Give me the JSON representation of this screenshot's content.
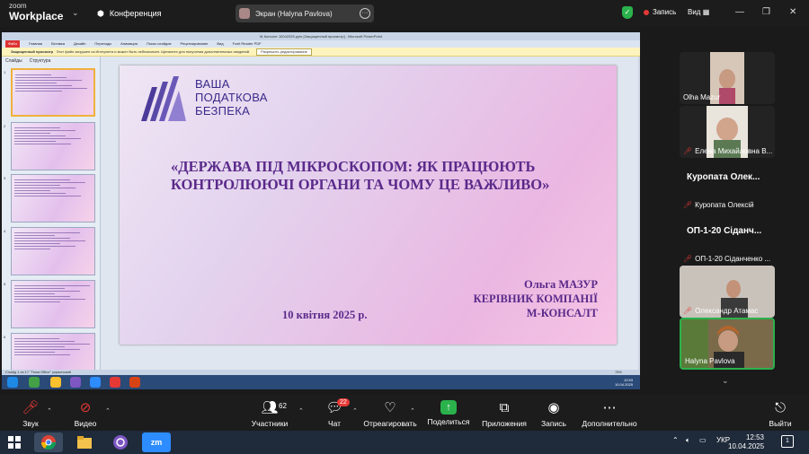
{
  "zoom": {
    "logo_top": "zoom",
    "logo_bottom": "Workplace",
    "conference_label": "Конференция",
    "share_label": "Экран (Halyna Pavlova)",
    "record_label": "Запись",
    "view_label": "Вид",
    "colors": {
      "accent_green": "#2bb24c",
      "record_red": "#e53935"
    }
  },
  "ppt": {
    "window_title": "М-Консалт 10042025.pptx [Защищенный просмотр] - Microsoft PowerPoint",
    "tabs": [
      "Файл",
      "Главная",
      "Вставка",
      "Дизайн",
      "Переходы",
      "Анимация",
      "Показ слайдов",
      "Рецензирование",
      "Вид",
      "Foxit Reader PDF"
    ],
    "warning_prefix": "Защищенный просмотр",
    "warning_text": "Этот файл загружен из Интернета и может быть небезопасен. Щелкните для получения дополнительных сведений.",
    "enable_editing": "Разрешить редактирование",
    "left_tabs": [
      "Слайды",
      "Структура"
    ],
    "thumb_numbers": [
      "1",
      "2",
      "3",
      "4",
      "5",
      "6"
    ],
    "status_text": "Слайд 1 из 17   \"Тема Office\"   украинский",
    "zoom_pct": "78%",
    "clock_time": "12:53",
    "clock_date": "10.04.2025"
  },
  "slide": {
    "logo_line1": "ВАША",
    "logo_line2": "ПОДАТКОВА",
    "logo_line3": "БЕЗПЕКА",
    "title": "«ДЕРЖАВА ПІД МІКРОСКОПОМ: ЯК ПРАЦЮЮТЬ КОНТРОЛЮЮЧІ ОРГАНИ ТА ЧОМУ ЦЕ ВАЖЛИВО»",
    "author_name": "Ольга МАЗУР",
    "author_role": "КЕРІВНИК КОМПАНІЇ",
    "author_company": "М-КОНСАЛТ",
    "date": "10 квітня 2025 р."
  },
  "participants": [
    {
      "name": "Olha Mazur",
      "muted": false
    },
    {
      "name": "Елена Михайловна В...",
      "muted": true
    },
    {
      "name": "Куропата Олексій",
      "big": "Куропата  Олек...",
      "muted": true
    },
    {
      "name": "ОП-1-20 Сіданченко ...",
      "big": "ОП-1-20  Сіданч...",
      "muted": true
    },
    {
      "name": "Олександр Атамас",
      "muted": true
    },
    {
      "name": "Halyna Pavlova",
      "muted": false
    }
  ],
  "toolbar": {
    "audio": "Звук",
    "video": "Видео",
    "participants": "Участники",
    "participants_count": "62",
    "chat": "Чат",
    "chat_badge": "22",
    "react": "Отреагировать",
    "share": "Поделиться",
    "apps": "Приложения",
    "record": "Запись",
    "more": "Дополнительно",
    "leave": "Выйти"
  },
  "windows": {
    "lang": "УКР",
    "time": "12:53",
    "date": "10.04.2025",
    "notif_count": "1"
  }
}
